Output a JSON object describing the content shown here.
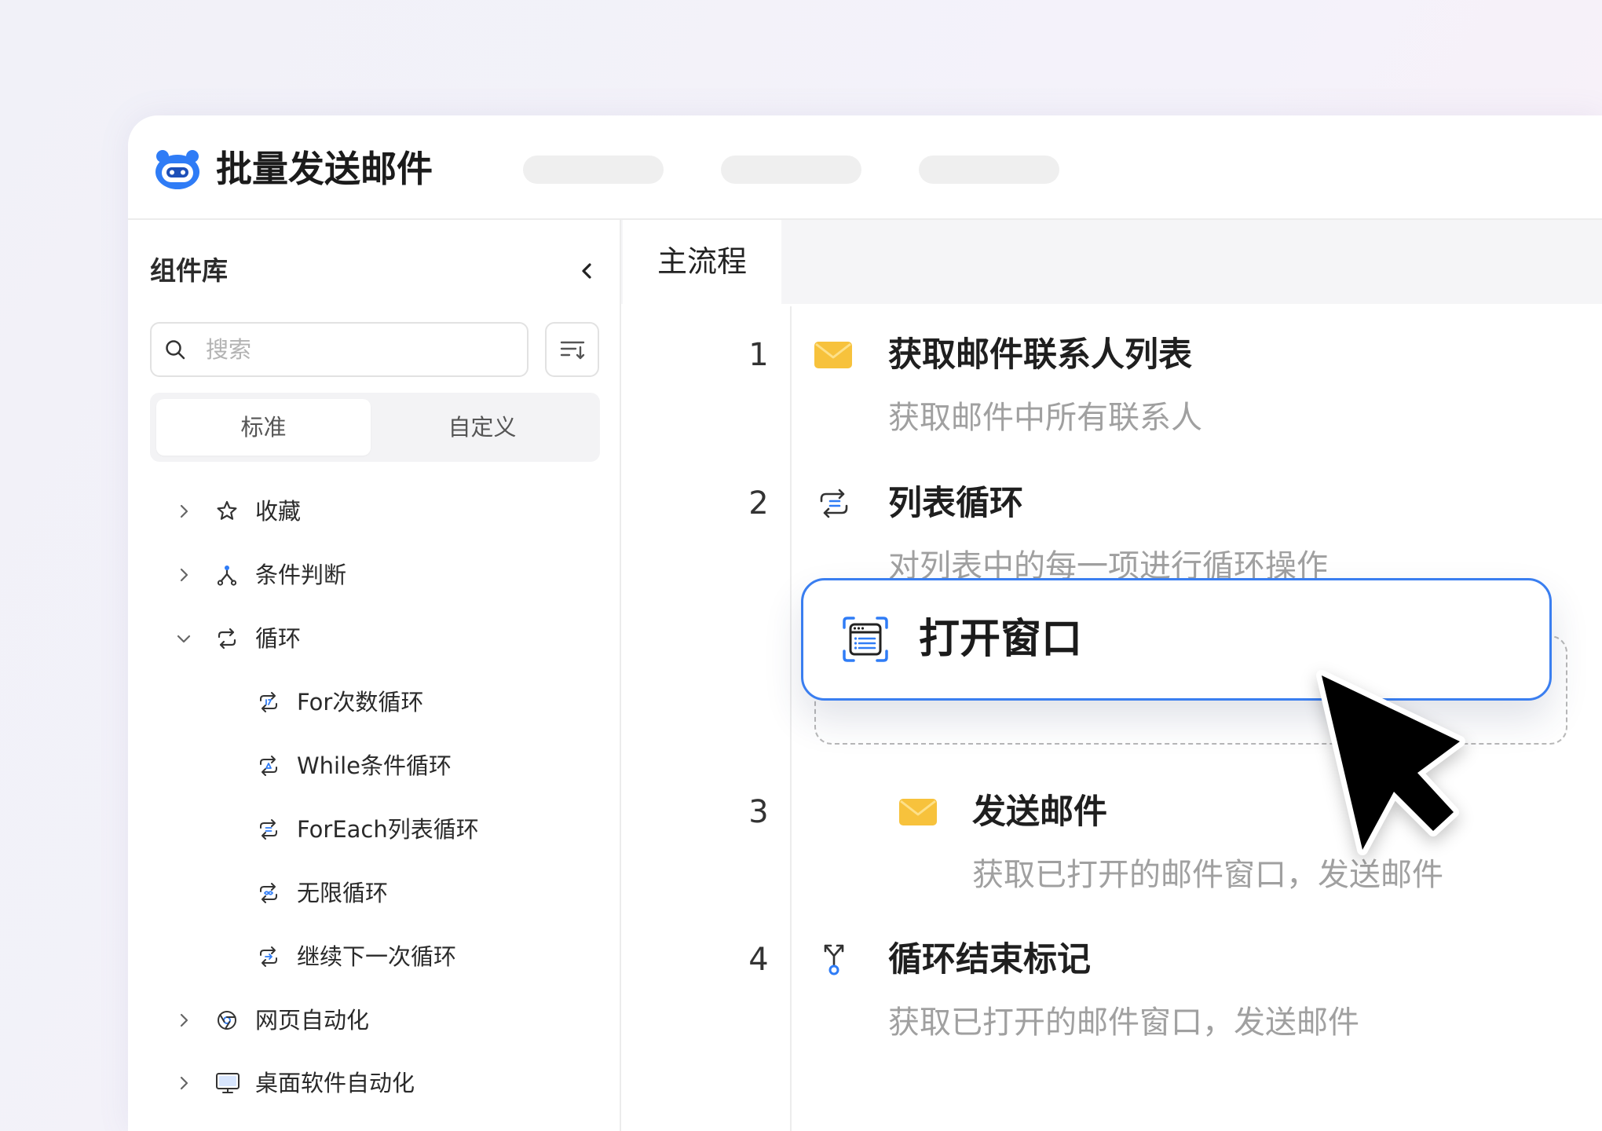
{
  "app": {
    "title": "批量发送邮件",
    "logo_icon": "robot-logo-icon"
  },
  "theme": {
    "accent": "#2f7cf6",
    "mail_icon": "#f7c23c",
    "text": "#222222",
    "muted_text": "#a0a0a0"
  },
  "sidebar": {
    "title": "组件库",
    "collapse_icon": "chevron-left-icon",
    "search": {
      "placeholder": "搜索",
      "value": "",
      "icon": "search-icon"
    },
    "sort_icon": "sort-filter-icon",
    "tabs": [
      {
        "label": "标准",
        "active": true
      },
      {
        "label": "自定义",
        "active": false
      }
    ],
    "tree": [
      {
        "label": "收藏",
        "icon": "star-icon",
        "level": 0,
        "expanded": false
      },
      {
        "label": "条件判断",
        "icon": "branch-icon",
        "level": 0,
        "expanded": false
      },
      {
        "label": "循环",
        "icon": "loop-icon",
        "level": 0,
        "expanded": true
      },
      {
        "label": "For次数循环",
        "icon": "for-loop-icon",
        "level": 1
      },
      {
        "label": "While条件循环",
        "icon": "while-loop-icon",
        "level": 1
      },
      {
        "label": "ForEach列表循环",
        "icon": "foreach-loop-icon",
        "level": 1
      },
      {
        "label": "无限循环",
        "icon": "infinite-loop-icon",
        "level": 1
      },
      {
        "label": "继续下一次循环",
        "icon": "continue-loop-icon",
        "level": 1
      },
      {
        "label": "网页自动化",
        "icon": "browser-icon",
        "level": 0,
        "expanded": false
      },
      {
        "label": "桌面软件自动化",
        "icon": "desktop-icon",
        "level": 0,
        "expanded": false
      }
    ]
  },
  "main": {
    "tabs": [
      {
        "label": "主流程",
        "active": true
      }
    ],
    "steps": [
      {
        "number": "1",
        "icon": "mail-icon",
        "title": "获取邮件联系人列表",
        "description": "获取邮件中所有联系人",
        "indent": 0
      },
      {
        "number": "2",
        "icon": "list-loop-icon",
        "title": "列表循环",
        "description": "对列表中的每一项进行循环操作",
        "indent": 0
      },
      {
        "number": "3",
        "icon": "mail-icon",
        "title": "发送邮件",
        "description": "获取已打开的邮件窗口，发送邮件",
        "indent": 1
      },
      {
        "number": "4",
        "icon": "loop-end-icon",
        "title": "循环结束标记",
        "description": "获取已打开的邮件窗口，发送邮件",
        "indent": 0
      }
    ],
    "dragging_item": {
      "title": "打开窗口",
      "icon": "window-icon"
    },
    "cursor_icon": "mouse-pointer-icon"
  }
}
